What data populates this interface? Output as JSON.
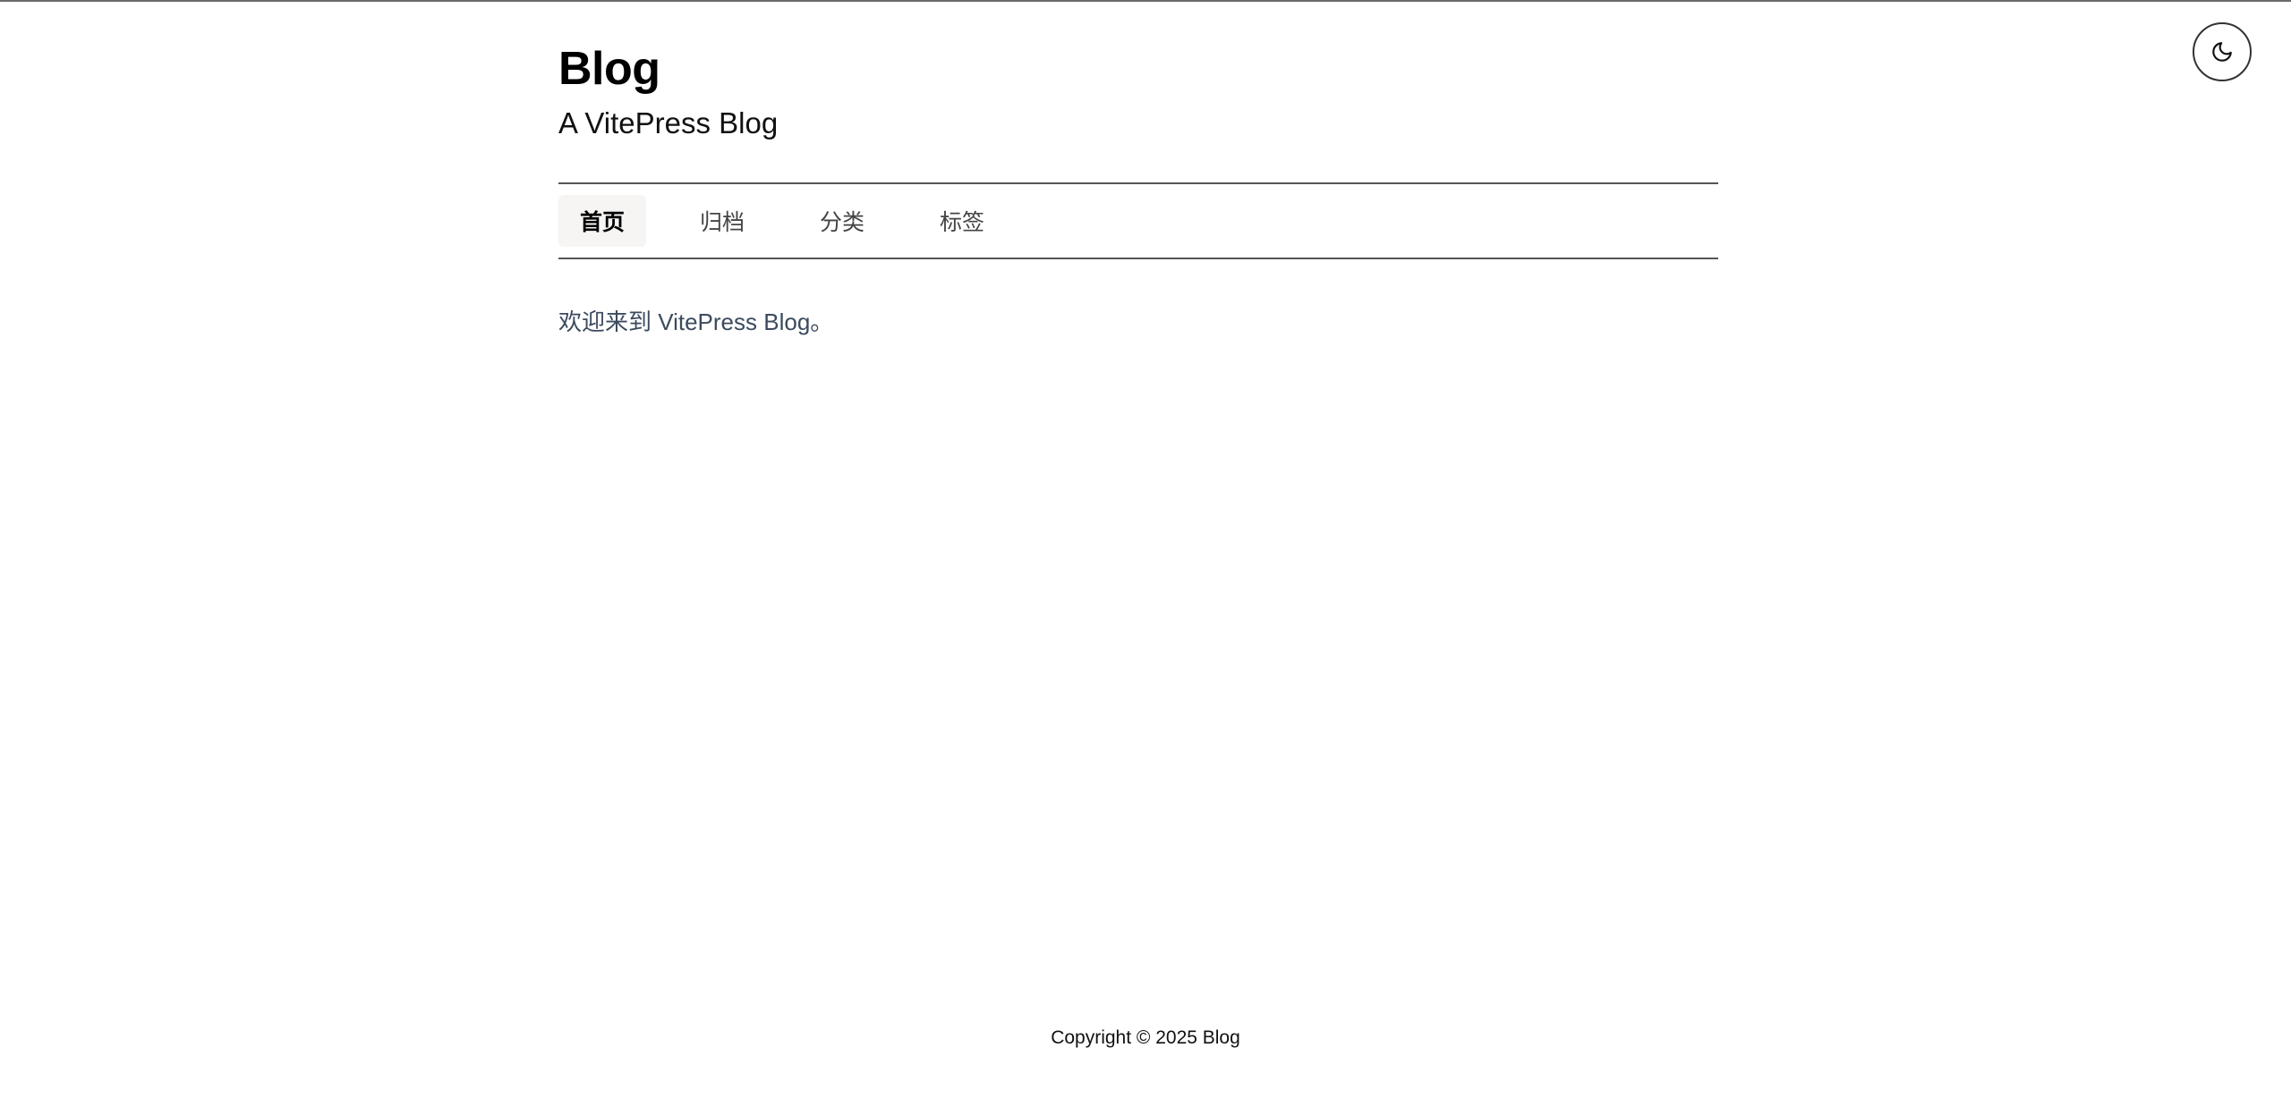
{
  "header": {
    "title": "Blog",
    "subtitle": "A VitePress Blog"
  },
  "theme_toggle": {
    "icon": "moon-icon"
  },
  "nav": {
    "items": [
      {
        "label": "首页",
        "active": true
      },
      {
        "label": "归档",
        "active": false
      },
      {
        "label": "分类",
        "active": false
      },
      {
        "label": "标签",
        "active": false
      }
    ]
  },
  "main": {
    "welcome_text": "欢迎来到 VitePress Blog。"
  },
  "footer": {
    "copyright": "Copyright © 2025 Blog"
  },
  "colors": {
    "background": "#ffffff",
    "active_nav_bg": "#f6f5f4",
    "body_text": "#3c4a5e",
    "border": "#555555"
  }
}
